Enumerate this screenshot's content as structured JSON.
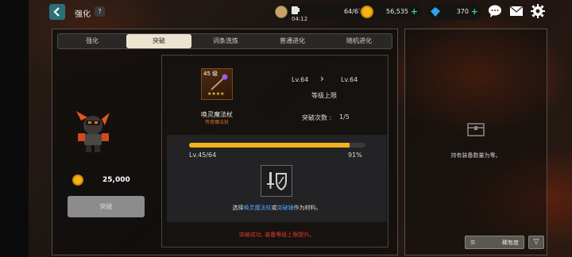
{
  "header": {
    "title": "强化",
    "help_label": "?",
    "resources": {
      "stamina": {
        "value": "64/67",
        "timer": "04:12",
        "plus": "+"
      },
      "gold": {
        "value": "56,535",
        "plus": "+"
      },
      "gem": {
        "value": "370",
        "plus": "+"
      }
    }
  },
  "tabs": [
    {
      "label": "强化"
    },
    {
      "label": "突破"
    },
    {
      "label": "词条洗炼"
    },
    {
      "label": "普通进化"
    },
    {
      "label": "随机进化"
    }
  ],
  "active_tab": "突破",
  "item": {
    "level_badge": "45 级",
    "stars": "★★★★",
    "name": "唤灵魔法杖",
    "grade": "传奇魔法杖"
  },
  "breakthrough": {
    "from_level": "Lv.64",
    "to_level": "Lv.64",
    "cap_label": "等级上限",
    "count_label": "突破次数 :",
    "count_value": "1/5",
    "progress_level": "Lv.45/64",
    "progress_percent_text": "91%",
    "progress_fraction": 0.91,
    "material_prefix": "选择",
    "material_a": "唤灵魔法杖",
    "material_or": "或",
    "material_b": "突破锤",
    "material_suffix": "作为材料。",
    "result_text": "突破成功, 装备等级上限提升。"
  },
  "cost": {
    "value": "25,000"
  },
  "action_button": {
    "label": "突破"
  },
  "inventory": {
    "empty_text": "持有装备数量为零。",
    "sort_label": "稀有度",
    "sort_order_icon": "▽"
  },
  "colors": {
    "accent_gold": "#f2b21d",
    "link_blue": "#4aa8ff",
    "warn_red": "#e23a2a",
    "tab_active": "#ece4cf",
    "legendary_orange": "#e0702a"
  }
}
